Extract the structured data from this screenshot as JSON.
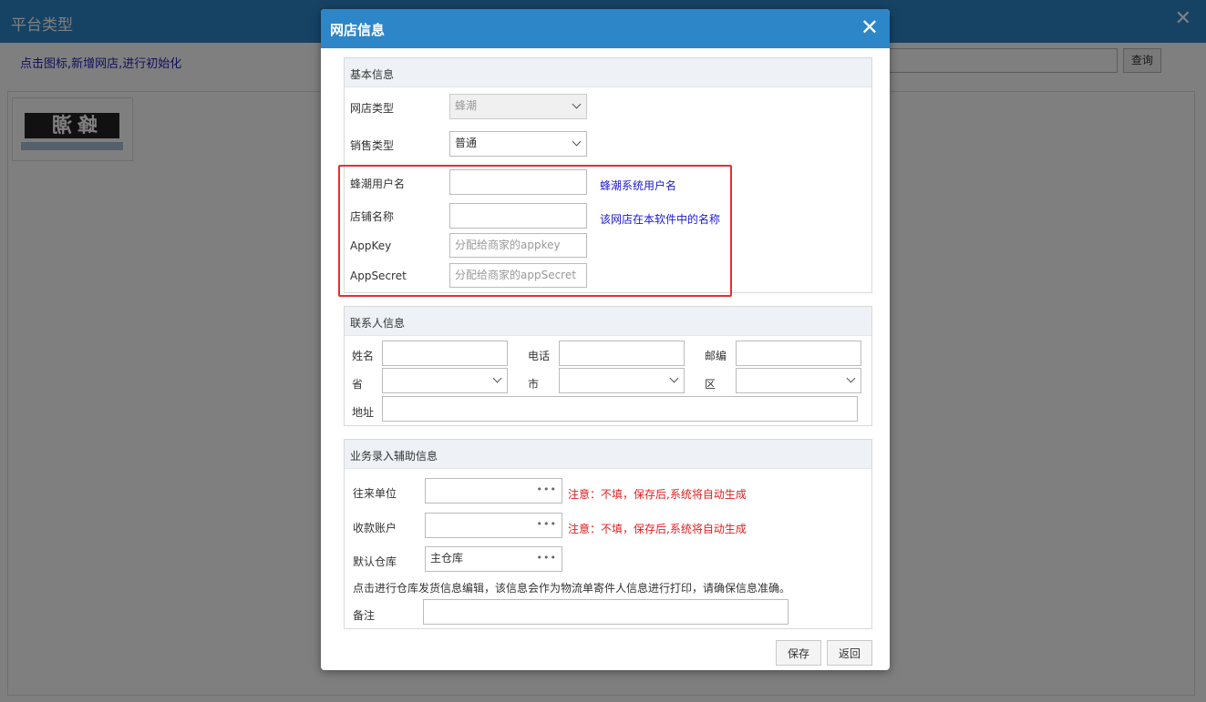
{
  "background": {
    "title": "平台类型",
    "close_icon": "close-icon",
    "hint": "点击图标,新增网店,进行初始化",
    "search_value": "",
    "query_button": "查询",
    "platform_logo_text": "蜂潮"
  },
  "dialog": {
    "title": "网店信息",
    "close_icon": "close-icon",
    "basic": {
      "header": "基本信息",
      "store_type_label": "网店类型",
      "store_type_value": "蜂潮",
      "sales_type_label": "销售类型",
      "sales_type_value": "普通",
      "username_label": "蜂潮用户名",
      "username_value": "",
      "username_note": "蜂潮系统用户名",
      "shop_name_label": "店铺名称",
      "shop_name_value": "",
      "shop_name_note": "该网店在本软件中的名称",
      "appkey_label": "AppKey",
      "appkey_placeholder": "分配给商家的appkey",
      "appsecret_label": "AppSecret",
      "appsecret_placeholder": "分配给商家的appSecret"
    },
    "contact": {
      "header": "联系人信息",
      "name_label": "姓名",
      "phone_label": "电话",
      "postcode_label": "邮编",
      "province_label": "省",
      "city_label": "市",
      "district_label": "区",
      "address_label": "地址"
    },
    "business": {
      "header": "业务录入辅助信息",
      "partner_label": "往来单位",
      "partner_value": "",
      "partner_note": "注意：不填，保存后,系统将自动生成",
      "account_label": "收款账户",
      "account_value": "",
      "account_note": "注意：不填，保存后,系统将自动生成",
      "warehouse_label": "默认仓库",
      "warehouse_value": "主仓库",
      "warehouse_hint": "点击进行仓库发货信息编辑，该信息会作为物流单寄件人信息进行打印，请确保信息准确。",
      "remark_label": "备注",
      "remark_value": ""
    },
    "buttons": {
      "save": "保存",
      "back": "返回"
    }
  },
  "colors": {
    "title_bar": "#2c86c8",
    "highlight_border": "#e53030",
    "note_blue": "#1a1acc",
    "note_red": "#e02020"
  }
}
